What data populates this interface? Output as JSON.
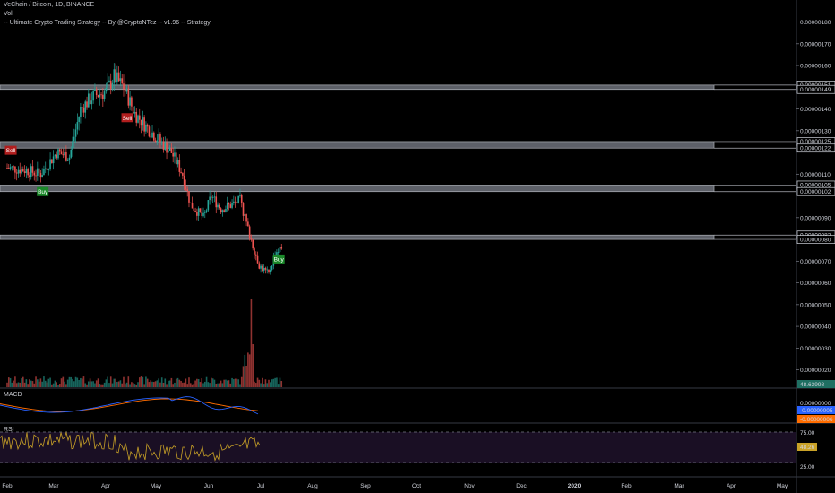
{
  "header": {
    "symbol_line": "VeChain / Bitcoin, 1D, BINANCE",
    "volume_label": "Vol",
    "strategy_line": "-- Ultimate Crypto Trading Strategy -- By @CryptoNTez -- v1.96 -- Strategy"
  },
  "panes": {
    "macd_label": "MACD",
    "rsi_label": "RSI"
  },
  "colors": {
    "bull": "#26a69a",
    "bear": "#ef5350",
    "zone": "#5d6068",
    "macd": "#2962ff",
    "signal": "#ff6d00",
    "rsi": "#c9a227",
    "rsi_band": "#1a0f24",
    "buy": "#1b8a2a",
    "sell": "#b11e1e"
  },
  "chart_data": {
    "type": "candlestick",
    "x_ticks": [
      "Feb",
      "Mar",
      "Apr",
      "May",
      "Jun",
      "Jul",
      "Aug",
      "Sep",
      "Oct",
      "Nov",
      "Dec",
      "2020",
      "Feb",
      "Mar",
      "Apr",
      "May"
    ],
    "y_ticks": [
      "0.00000180",
      "0.00000170",
      "0.00000160",
      "0.00000140",
      "0.00000130",
      "0.00000110",
      "0.00000090",
      "0.00000070",
      "0.00000060",
      "0.00000050",
      "0.00000040",
      "0.00000030",
      "0.00000020"
    ],
    "y_price_tags": [
      "0.00000151",
      "0.00000149",
      "0.00000125",
      "0.00000122",
      "0.00000105",
      "0.00000102",
      "0.00000082",
      "0.00000080"
    ],
    "last_price_tag": "48.63998",
    "ylim": [
      1.2e-07,
      1.86e-06
    ],
    "zones": [
      {
        "top": 1.51e-06,
        "bottom": 1.49e-06
      },
      {
        "top": 1.25e-06,
        "bottom": 1.22e-06
      },
      {
        "top": 1.05e-06,
        "bottom": 1.02e-06
      },
      {
        "top": 8.2e-07,
        "bottom": 8e-07
      }
    ],
    "close_series": [
      {
        "date": "2019-01-25",
        "close": 1.13e-06
      },
      {
        "date": "2019-02-05",
        "close": 1.12e-06
      },
      {
        "date": "2019-02-15",
        "close": 1.1e-06
      },
      {
        "date": "2019-02-25",
        "close": 1.2e-06
      },
      {
        "date": "2019-03-05",
        "close": 1.18e-06
      },
      {
        "date": "2019-03-12",
        "close": 1.4e-06
      },
      {
        "date": "2019-03-20",
        "close": 1.46e-06
      },
      {
        "date": "2019-03-28",
        "close": 1.48e-06
      },
      {
        "date": "2019-04-02",
        "close": 1.55e-06
      },
      {
        "date": "2019-04-08",
        "close": 1.5e-06
      },
      {
        "date": "2019-04-15",
        "close": 1.38e-06
      },
      {
        "date": "2019-04-22",
        "close": 1.32e-06
      },
      {
        "date": "2019-04-30",
        "close": 1.26e-06
      },
      {
        "date": "2019-05-08",
        "close": 1.2e-06
      },
      {
        "date": "2019-05-15",
        "close": 1.1e-06
      },
      {
        "date": "2019-05-20",
        "close": 9.6e-07
      },
      {
        "date": "2019-05-28",
        "close": 9e-07
      },
      {
        "date": "2019-06-02",
        "close": 1e-06
      },
      {
        "date": "2019-06-08",
        "close": 9.4e-07
      },
      {
        "date": "2019-06-15",
        "close": 9.6e-07
      },
      {
        "date": "2019-06-20",
        "close": 9.8e-07
      },
      {
        "date": "2019-06-26",
        "close": 8.2e-07
      },
      {
        "date": "2019-07-02",
        "close": 6.8e-07
      },
      {
        "date": "2019-07-08",
        "close": 6.4e-07
      },
      {
        "date": "2019-07-12",
        "close": 7.4e-07
      },
      {
        "date": "2019-07-16",
        "close": 7.6e-07
      }
    ],
    "signals": [
      {
        "label": "Sell",
        "date": "2019-01-27",
        "price": 1.21e-06,
        "side": "sell"
      },
      {
        "label": "Buy",
        "date": "2019-02-16",
        "price": 1.02e-06,
        "side": "buy"
      },
      {
        "label": "Sell",
        "date": "2019-04-10",
        "price": 1.36e-06,
        "side": "sell"
      },
      {
        "label": "Buy",
        "date": "2019-07-14",
        "price": 7.1e-07,
        "side": "buy"
      }
    ],
    "rsi": {
      "upper": "75.00",
      "lower": "25.00",
      "last": "48.26"
    },
    "macd": {
      "last_macd": "-0.00000005",
      "last_signal": "-0.00000006",
      "zero": "0.00000000"
    }
  }
}
